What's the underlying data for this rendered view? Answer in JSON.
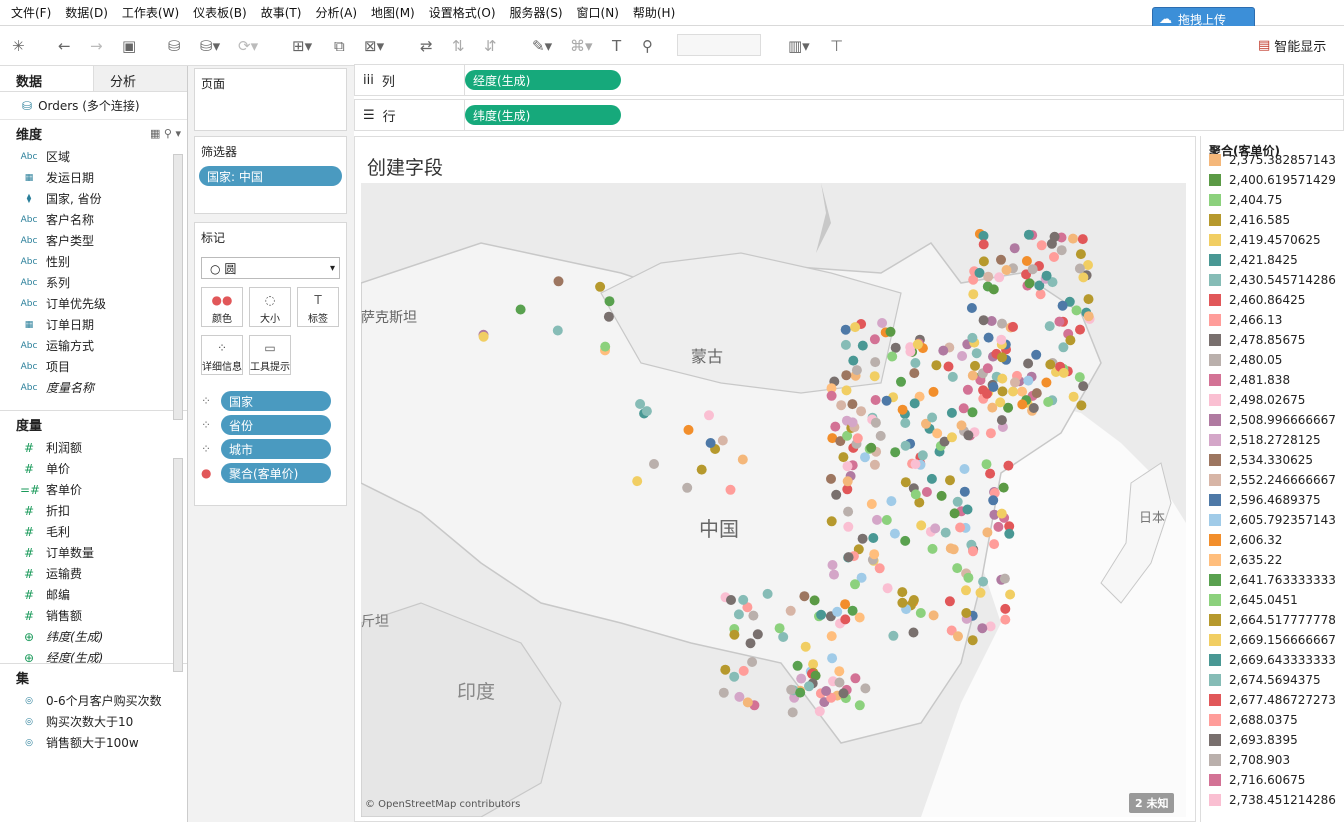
{
  "menu": [
    "文件(F)",
    "数据(D)",
    "工作表(W)",
    "仪表板(B)",
    "故事(T)",
    "分析(A)",
    "地图(M)",
    "设置格式(O)",
    "服务器(S)",
    "窗口(N)",
    "帮助(H)"
  ],
  "upload_label": "拖拽上传",
  "smart_show": "智能显示",
  "left_tabs": {
    "data": "数据",
    "analysis": "分析"
  },
  "datasource": "Orders (多个连接)",
  "dimensions_header": "维度",
  "dimensions": [
    {
      "type": "Abc",
      "name": "区域",
      "italic": false
    },
    {
      "type": "date",
      "name": "发运日期",
      "italic": false
    },
    {
      "type": "hier",
      "name": "国家, 省份",
      "italic": false
    },
    {
      "type": "Abc",
      "name": "客户名称",
      "italic": false
    },
    {
      "type": "Abc",
      "name": "客户类型",
      "italic": false
    },
    {
      "type": "Abc",
      "name": "性别",
      "italic": false
    },
    {
      "type": "Abc",
      "name": "系列",
      "italic": false
    },
    {
      "type": "Abc",
      "name": "订单优先级",
      "italic": false
    },
    {
      "type": "date",
      "name": "订单日期",
      "italic": false
    },
    {
      "type": "Abc",
      "name": "运输方式",
      "italic": false
    },
    {
      "type": "Abc",
      "name": "项目",
      "italic": false
    },
    {
      "type": "Abc",
      "name": "度量名称",
      "italic": true
    }
  ],
  "measures_header": "度量",
  "measures": [
    {
      "type": "#",
      "name": "利润额",
      "italic": false
    },
    {
      "type": "#",
      "name": "单价",
      "italic": false
    },
    {
      "type": "=#",
      "name": "客单价",
      "italic": false
    },
    {
      "type": "#",
      "name": "折扣",
      "italic": false
    },
    {
      "type": "#",
      "name": "毛利",
      "italic": false
    },
    {
      "type": "#",
      "name": "订单数量",
      "italic": false
    },
    {
      "type": "#",
      "name": "运输费",
      "italic": false
    },
    {
      "type": "#",
      "name": "邮编",
      "italic": false
    },
    {
      "type": "#",
      "name": "销售额",
      "italic": false
    },
    {
      "type": "geo",
      "name": "纬度(生成)",
      "italic": true
    },
    {
      "type": "geo",
      "name": "经度(生成)",
      "italic": true
    }
  ],
  "sets_header": "集",
  "sets": [
    "0-6个月客户购买次数",
    "购买次数大于10",
    "销售额大于100w"
  ],
  "pages_label": "页面",
  "filters_label": "筛选器",
  "filter_pill": "国家: 中国",
  "marks_label": "标记",
  "mark_type": "圆",
  "mark_buttons": {
    "color": "颜色",
    "size": "大小",
    "label": "标签",
    "detail": "详细信息",
    "tooltip": "工具提示"
  },
  "mark_pills": [
    "国家",
    "省份",
    "城市",
    "聚合(客单价)"
  ],
  "columns_label": "列",
  "rows_label": "行",
  "columns_pill": "经度(生成)",
  "rows_pill": "纬度(生成)",
  "viz_title": "创建字段",
  "map_labels": {
    "china": "中国",
    "mongolia": "蒙古",
    "india": "印度",
    "japan": "日本",
    "kazakhstan": "萨克斯坦",
    "pakistan": "斤坦"
  },
  "attribution": "© OpenStreetMap contributors",
  "unknown_badge": "2 未知",
  "legend_title": "聚合(客单价)",
  "legend_items": [
    {
      "value": "2,375.382857143",
      "color": "#f4b77a"
    },
    {
      "value": "2,400.619571429",
      "color": "#5b9a45"
    },
    {
      "value": "2,404.75",
      "color": "#8cd17d"
    },
    {
      "value": "2,416.585",
      "color": "#b6992d"
    },
    {
      "value": "2,419.4570625",
      "color": "#f1ce63"
    },
    {
      "value": "2,421.8425",
      "color": "#499894"
    },
    {
      "value": "2,430.545714286",
      "color": "#86bcb6"
    },
    {
      "value": "2,460.86425",
      "color": "#e15759"
    },
    {
      "value": "2,466.13",
      "color": "#ff9d9a"
    },
    {
      "value": "2,478.85675",
      "color": "#79706e"
    },
    {
      "value": "2,480.05",
      "color": "#bab0ac"
    },
    {
      "value": "2,481.838",
      "color": "#d37295"
    },
    {
      "value": "2,498.02675",
      "color": "#fabfd2"
    },
    {
      "value": "2,508.996666667",
      "color": "#b07aa1"
    },
    {
      "value": "2,518.2728125",
      "color": "#d4a6c8"
    },
    {
      "value": "2,534.330625",
      "color": "#9d7660"
    },
    {
      "value": "2,552.246666667",
      "color": "#d7b5a6"
    },
    {
      "value": "2,596.4689375",
      "color": "#4e79a7"
    },
    {
      "value": "2,605.792357143",
      "color": "#a0cbe8"
    },
    {
      "value": "2,606.32",
      "color": "#f28e2b"
    },
    {
      "value": "2,635.22",
      "color": "#ffbe7d"
    },
    {
      "value": "2,641.763333333",
      "color": "#59a14f"
    },
    {
      "value": "2,645.0451",
      "color": "#8cd17d"
    },
    {
      "value": "2,664.517777778",
      "color": "#b6992d"
    },
    {
      "value": "2,669.156666667",
      "color": "#f1ce63"
    },
    {
      "value": "2,669.643333333",
      "color": "#499894"
    },
    {
      "value": "2,674.5694375",
      "color": "#86bcb6"
    },
    {
      "value": "2,677.486727273",
      "color": "#e15759"
    },
    {
      "value": "2,688.0375",
      "color": "#ff9d9a"
    },
    {
      "value": "2,693.8395",
      "color": "#79706e"
    },
    {
      "value": "2,708.903",
      "color": "#bab0ac"
    },
    {
      "value": "2,716.60675",
      "color": "#d37295"
    },
    {
      "value": "2,738.451214286",
      "color": "#fabfd2"
    }
  ]
}
